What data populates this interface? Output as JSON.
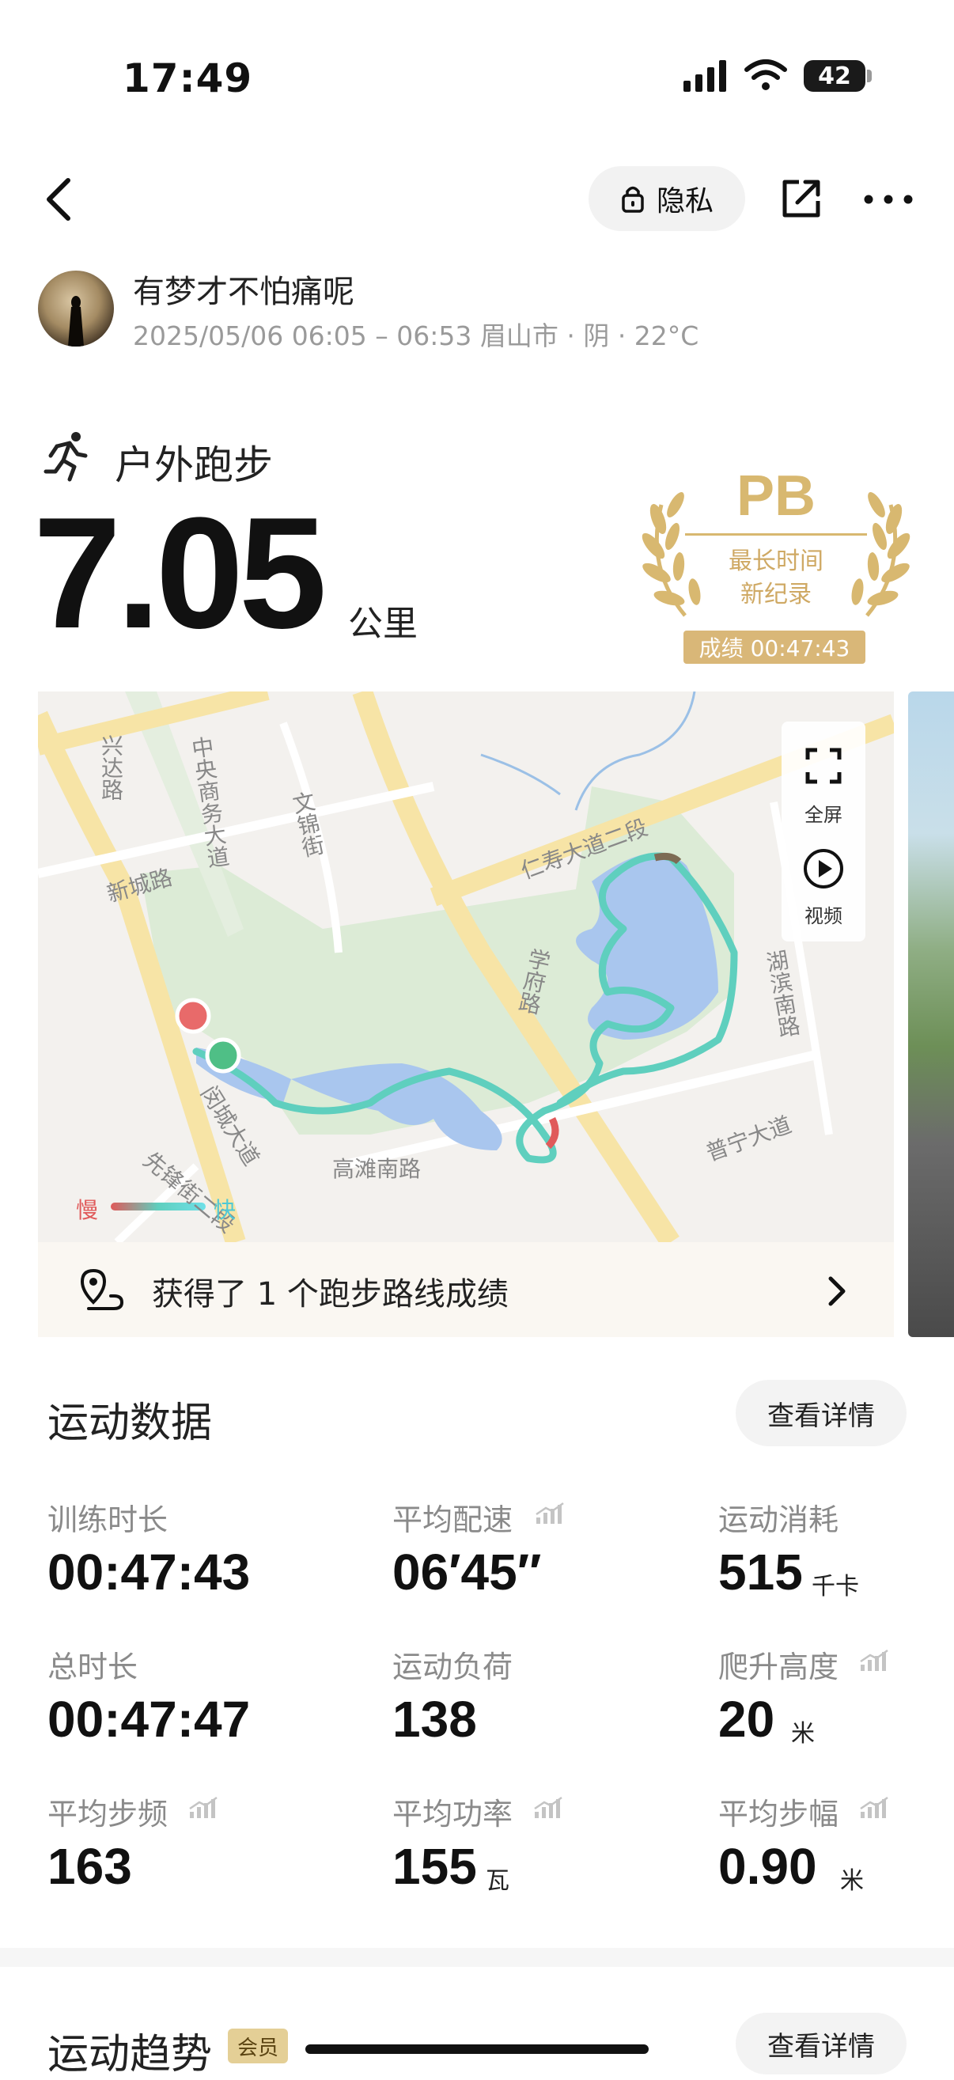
{
  "status_bar": {
    "time": "17:49",
    "battery": "42"
  },
  "nav": {
    "privacy_label": "隐私"
  },
  "user": {
    "name": "有梦才不怕痛呢",
    "meta": "2025/05/06 06:05 – 06:53 眉山市 · 阴 · 22°C"
  },
  "workout": {
    "type": "户外跑步",
    "distance": "7.05",
    "distance_unit": "公里"
  },
  "pb_badge": {
    "title": "PB",
    "line1": "最长时间",
    "line2": "新纪录",
    "score": "成绩 00:47:43"
  },
  "map": {
    "fullscreen_label": "全屏",
    "video_label": "视频",
    "legend_slow": "慢",
    "legend_fast": "快",
    "labels": [
      "兴达路",
      "中央商务大道",
      "文锦街",
      "新城路",
      "仁寿大道二段",
      "学府路",
      "湖滨南路",
      "高滩南路",
      "普宁大道",
      "先锋街二段",
      "闵城大道"
    ],
    "route_message": "获得了 1 个跑步路线成绩"
  },
  "stats": {
    "title": "运动数据",
    "detail_label": "查看详情",
    "items": [
      {
        "label": "训练时长",
        "value": "00:47:43",
        "unit": ""
      },
      {
        "label": "平均配速",
        "value": "06′45″",
        "unit": ""
      },
      {
        "label": "运动消耗",
        "value": "515",
        "unit": "千卡"
      },
      {
        "label": "总时长",
        "value": "00:47:47",
        "unit": ""
      },
      {
        "label": "运动负荷",
        "value": "138",
        "unit": ""
      },
      {
        "label": "爬升高度",
        "value": "20",
        "unit": "米"
      },
      {
        "label": "平均步频",
        "value": "163",
        "unit": ""
      },
      {
        "label": "平均功率",
        "value": "155",
        "unit": "瓦"
      },
      {
        "label": "平均步幅",
        "value": "0.90",
        "unit": "米"
      }
    ]
  },
  "trend": {
    "title": "运动趋势",
    "badge": "会员",
    "detail_label": "查看详情"
  },
  "colors": {
    "gold": "#d8b870",
    "route_slow": "#e05a5a",
    "route_fast": "#5fd6d6"
  }
}
